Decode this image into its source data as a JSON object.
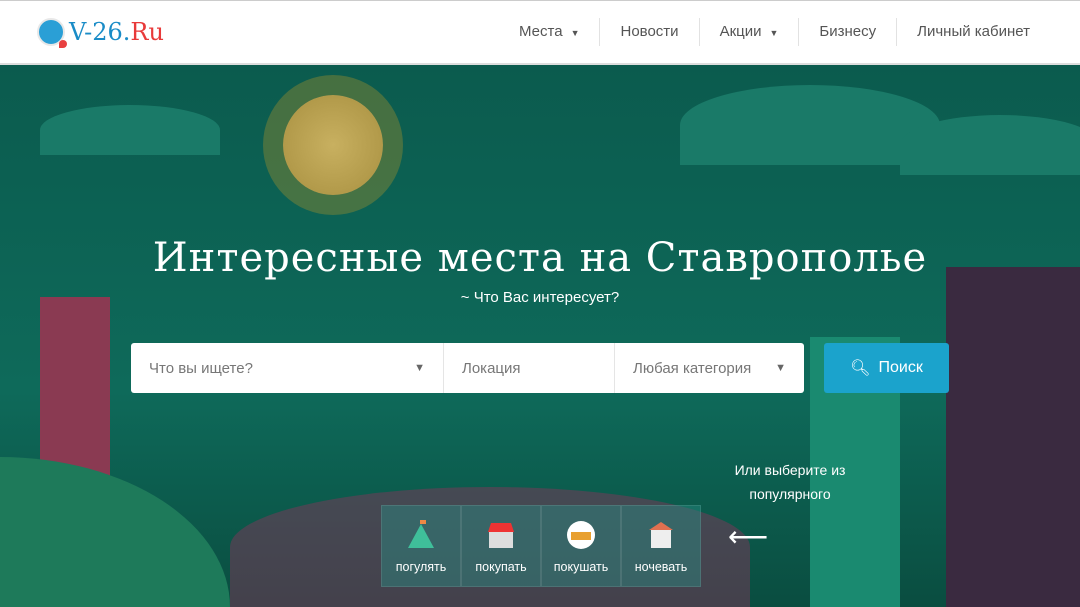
{
  "header": {
    "logo_main": "V-26.",
    "logo_ru": "Ru",
    "nav": [
      {
        "label": "Места",
        "dropdown": true
      },
      {
        "label": "Новости"
      },
      {
        "label": "Акции",
        "dropdown": true
      },
      {
        "label": "Бизнесу"
      },
      {
        "label": "Личный кабинет"
      }
    ]
  },
  "hero": {
    "title": "Интересные места на Ставрополье",
    "subtitle": "~ Что Вас интересует?"
  },
  "search": {
    "what_placeholder": "Что вы ищете?",
    "location_placeholder": "Локация",
    "category": "Любая категория",
    "button": "Поиск"
  },
  "popular": {
    "hint": "Или выберите из популярного",
    "items": [
      {
        "label": "погулять",
        "icon": "mountain-icon"
      },
      {
        "label": "покупать",
        "icon": "shop-icon"
      },
      {
        "label": "покушать",
        "icon": "food-icon"
      },
      {
        "label": "ночевать",
        "icon": "hotel-icon"
      }
    ]
  }
}
